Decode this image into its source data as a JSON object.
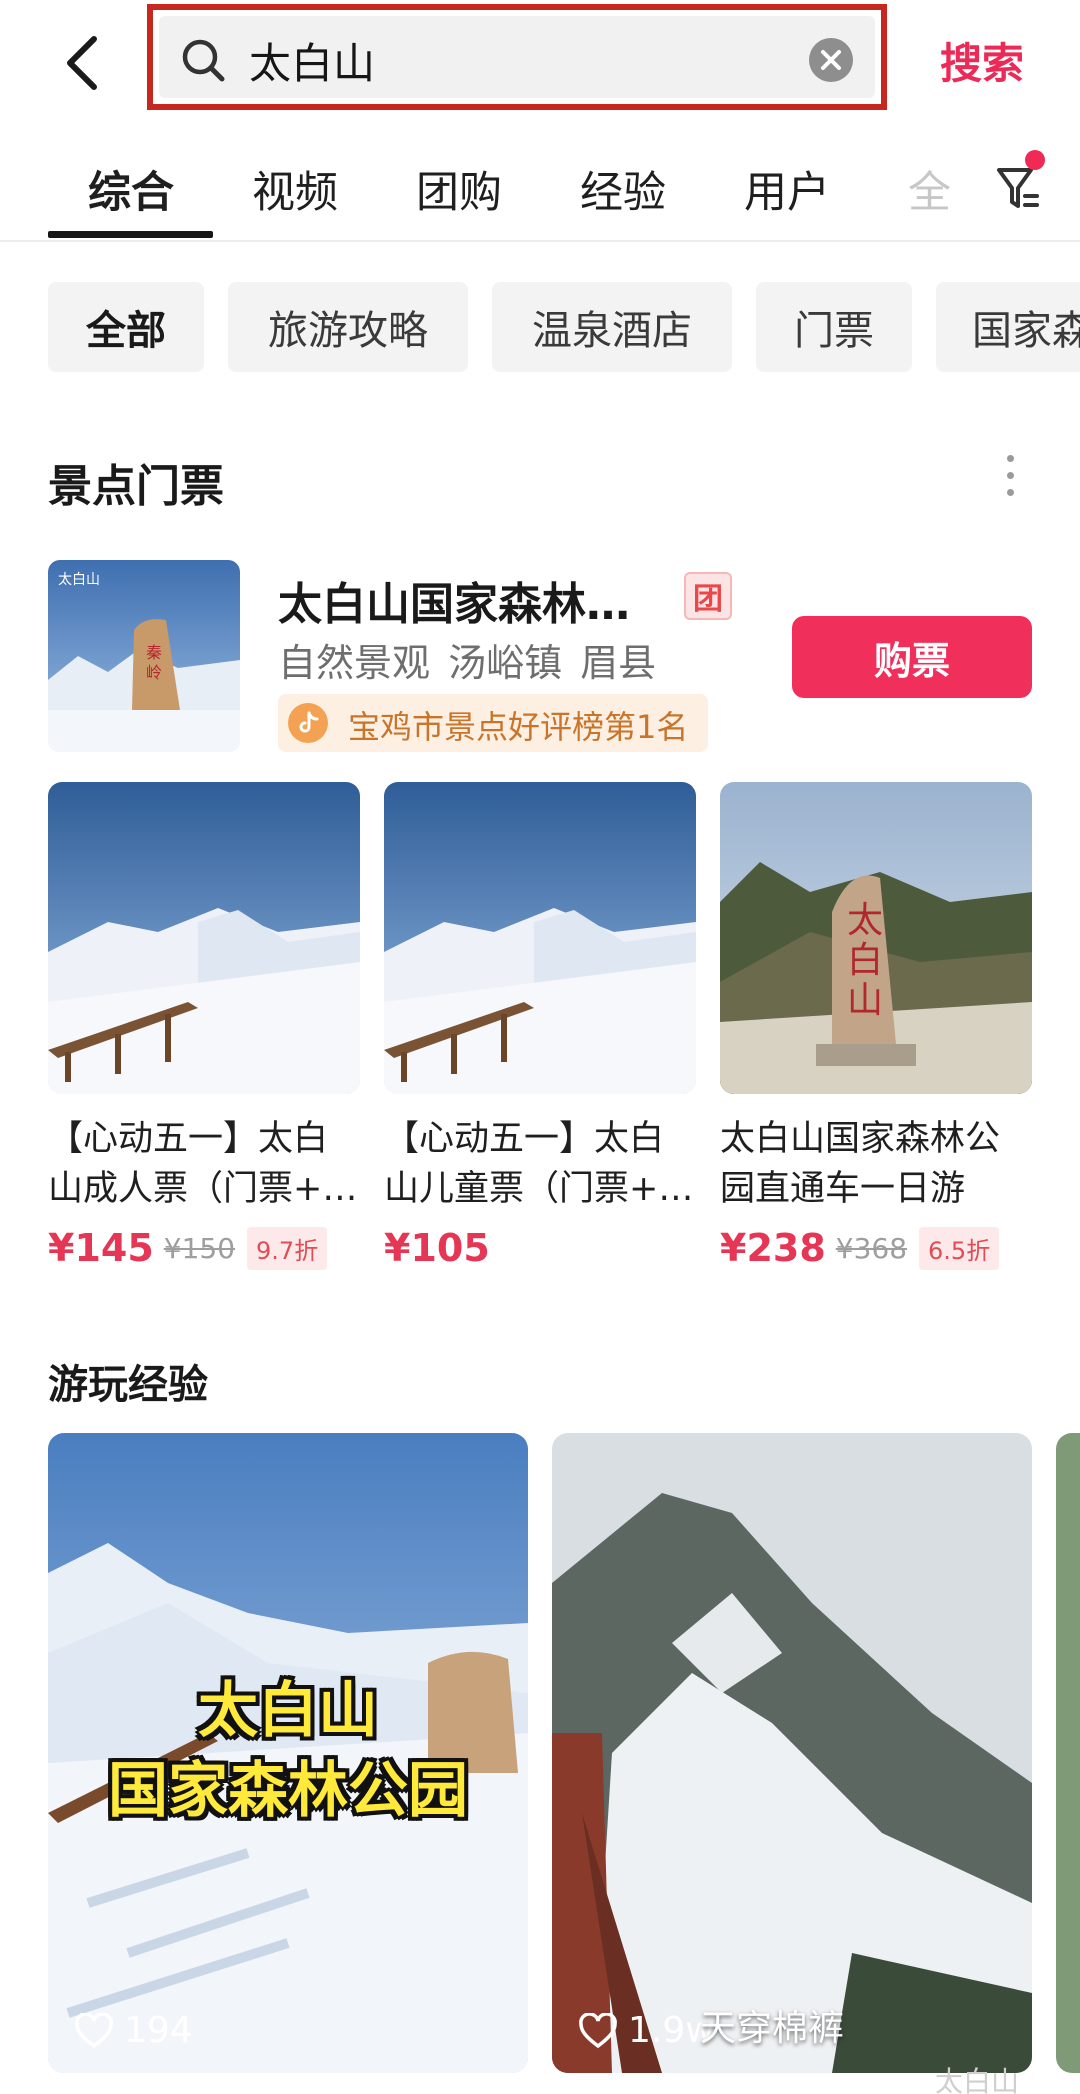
{
  "search": {
    "query": "太白山",
    "submit_label": "搜索"
  },
  "tabs": [
    {
      "label": "综合",
      "active": true
    },
    {
      "label": "视频"
    },
    {
      "label": "团购"
    },
    {
      "label": "经验"
    },
    {
      "label": "用户"
    },
    {
      "label": "全"
    }
  ],
  "chips": [
    {
      "label": "全部",
      "active": true
    },
    {
      "label": "旅游攻略"
    },
    {
      "label": "温泉酒店"
    },
    {
      "label": "门票"
    },
    {
      "label": "国家森"
    }
  ],
  "tickets_section": {
    "title": "景点门票",
    "attraction": {
      "name": "太白山国家森林…",
      "badge": "团",
      "meta": "自然景观 汤峪镇 眉县",
      "rank": "宝鸡市景点好评榜第1名",
      "buy_label": "购票",
      "thumb_inscription": "太白山"
    },
    "products": [
      {
        "title": "【心动五一】太白山成人票（门票+…",
        "price": "¥145",
        "old_price": "¥150",
        "discount": "9.7折"
      },
      {
        "title": "【心动五一】太白山儿童票（门票+…",
        "price": "¥105",
        "old_price": "",
        "discount": ""
      },
      {
        "title": "太白山国家森林公园直通车一日游",
        "price": "¥238",
        "old_price": "¥368",
        "discount": "6.5折"
      }
    ]
  },
  "experience_section": {
    "title": "游玩经验",
    "cards": [
      {
        "overlay_line1": "太白山",
        "overlay_line2": "国家森林公园",
        "likes": "194"
      },
      {
        "likes": "1.9w",
        "tag": "天穿棉裤"
      }
    ]
  },
  "watermark": "太白山",
  "colors": {
    "accent": "#ec2a58",
    "buy_button": "#f0305b",
    "price": "#e53655",
    "highlight_border": "#c6271f"
  }
}
